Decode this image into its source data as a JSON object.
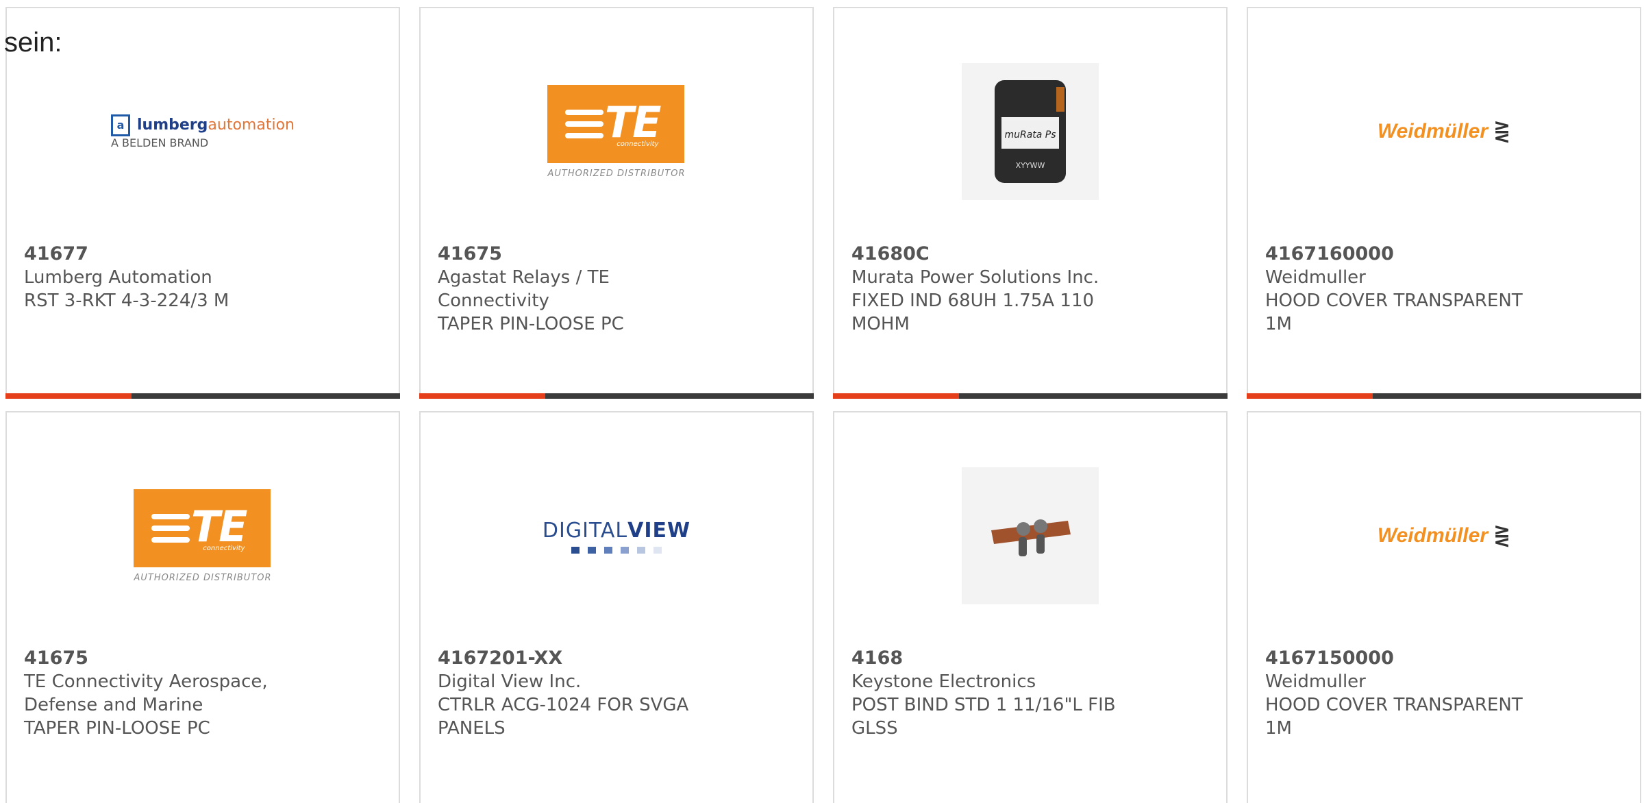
{
  "intro_text": "sein:",
  "products": [
    {
      "part": "41677",
      "manufacturer": "Lumberg Automation",
      "description": "RST 3-RKT 4-3-224/3 M",
      "logo": "lumberg-logo",
      "logo_text": "lumbergautomation",
      "logo_sub": "A BELDEN BRAND"
    },
    {
      "part": "41675",
      "manufacturer": "Agastat Relays / TE Connectivity",
      "description": "TAPER PIN-LOOSE PC",
      "logo": "te-logo",
      "logo_text": "TE",
      "logo_sub": "AUTHORIZED DISTRIBUTOR"
    },
    {
      "part": "41680C",
      "manufacturer": "Murata Power Solutions Inc.",
      "description": "FIXED IND 68UH 1.75A 110 MOHM",
      "logo": "inductor-image",
      "logo_text": "muRata Ps",
      "logo_sub": "XYYWW"
    },
    {
      "part": "4167160000",
      "manufacturer": "Weidmuller",
      "description": "HOOD COVER TRANSPARENT 1M",
      "logo": "weidmuller-logo",
      "logo_text": "Weidmüller",
      "logo_sub": ""
    },
    {
      "part": "41675",
      "manufacturer": "TE Connectivity Aerospace, Defense and Marine",
      "description": "TAPER PIN-LOOSE PC",
      "logo": "te-logo",
      "logo_text": "TE",
      "logo_sub": "AUTHORIZED DISTRIBUTOR"
    },
    {
      "part": "4167201-XX",
      "manufacturer": "Digital View Inc.",
      "description": "CTRLR ACG-1024 FOR SVGA PANELS",
      "logo": "digitalview-logo",
      "logo_text": "DIGITALVIEW",
      "logo_sub": ""
    },
    {
      "part": "4168",
      "manufacturer": "Keystone Electronics",
      "description": "POST BIND STD 1 11/16\"L FIB GLSS",
      "logo": "binding-post-image",
      "logo_text": "",
      "logo_sub": ""
    },
    {
      "part": "4167150000",
      "manufacturer": "Weidmuller",
      "description": "HOOD COVER TRANSPARENT 1M",
      "logo": "weidmuller-logo",
      "logo_text": "Weidmüller",
      "logo_sub": ""
    }
  ],
  "colors": {
    "accent": "#e53e1b",
    "bar": "#3b3b3b",
    "te_orange": "#f29122"
  }
}
